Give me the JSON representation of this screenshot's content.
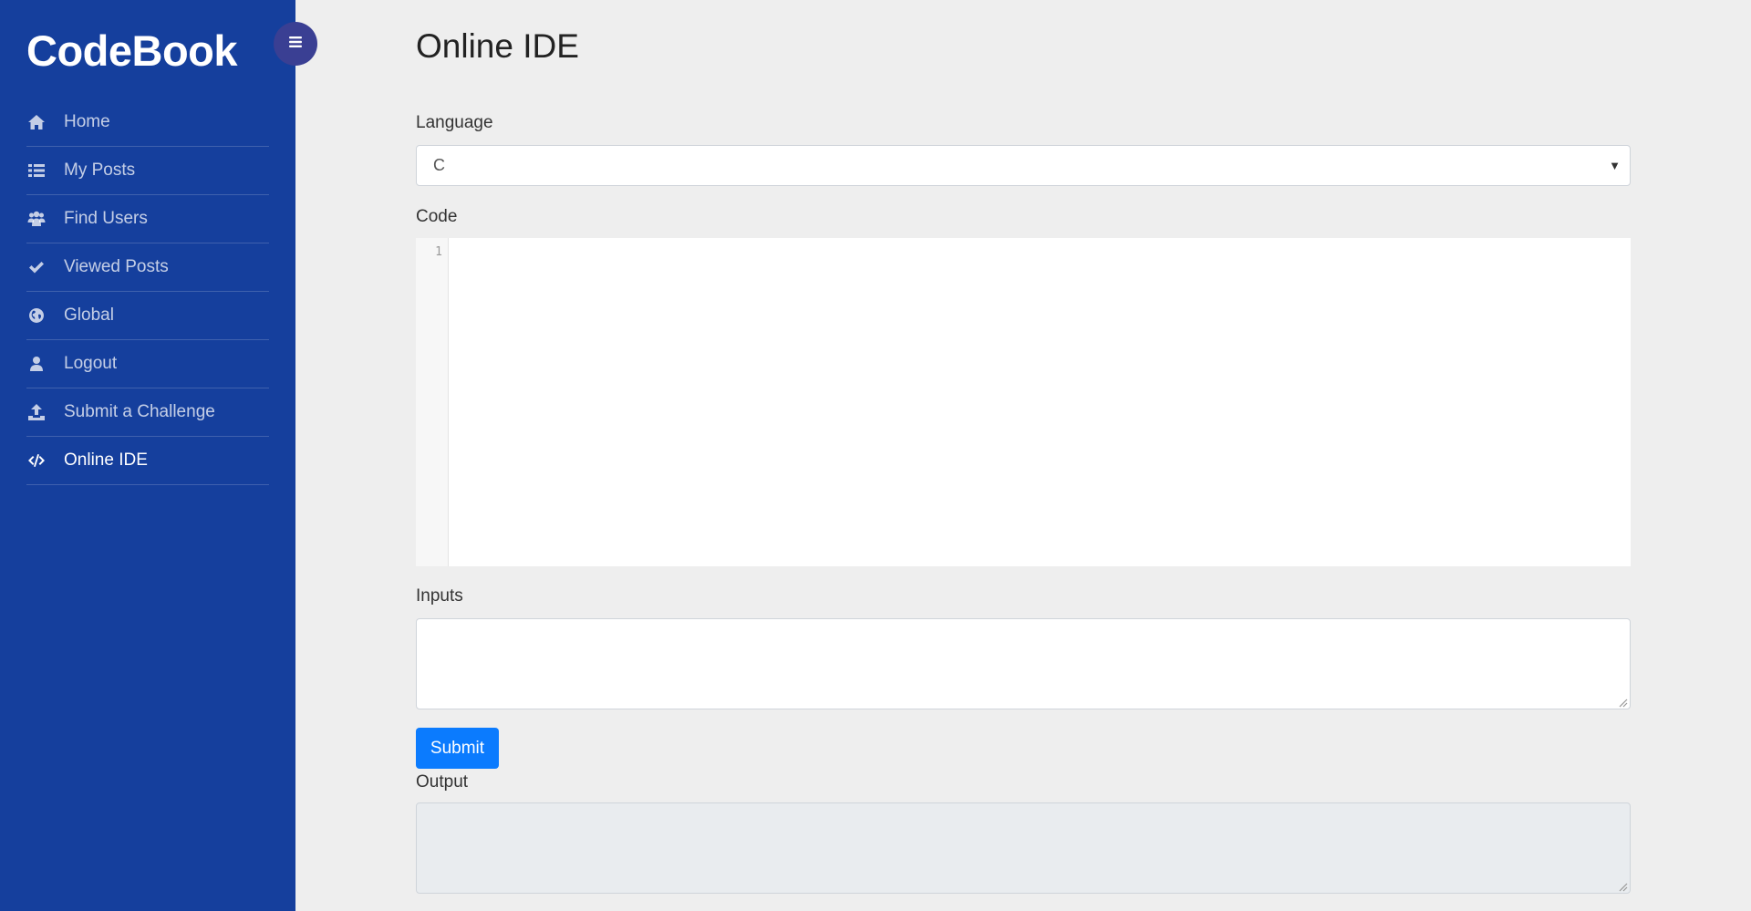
{
  "sidebar": {
    "brand": "CodeBook",
    "items": [
      {
        "label": "Home",
        "icon": "home-icon"
      },
      {
        "label": "My Posts",
        "icon": "list-icon"
      },
      {
        "label": "Find Users",
        "icon": "users-icon"
      },
      {
        "label": "Viewed Posts",
        "icon": "check-icon"
      },
      {
        "label": "Global",
        "icon": "globe-icon"
      },
      {
        "label": "Logout",
        "icon": "user-icon"
      },
      {
        "label": "Submit a Challenge",
        "icon": "upload-icon"
      },
      {
        "label": "Online IDE",
        "icon": "code-icon",
        "active": true
      }
    ]
  },
  "main": {
    "title": "Online IDE",
    "language_label": "Language",
    "language_value": "C",
    "code_label": "Code",
    "line_number": "1",
    "inputs_label": "Inputs",
    "submit_label": "Submit",
    "output_label": "Output"
  },
  "colors": {
    "sidebar_bg": "#153f9d",
    "toggle_bg": "#3a3f93",
    "primary_button": "#0b7bfe",
    "page_bg": "#eeeeee"
  }
}
